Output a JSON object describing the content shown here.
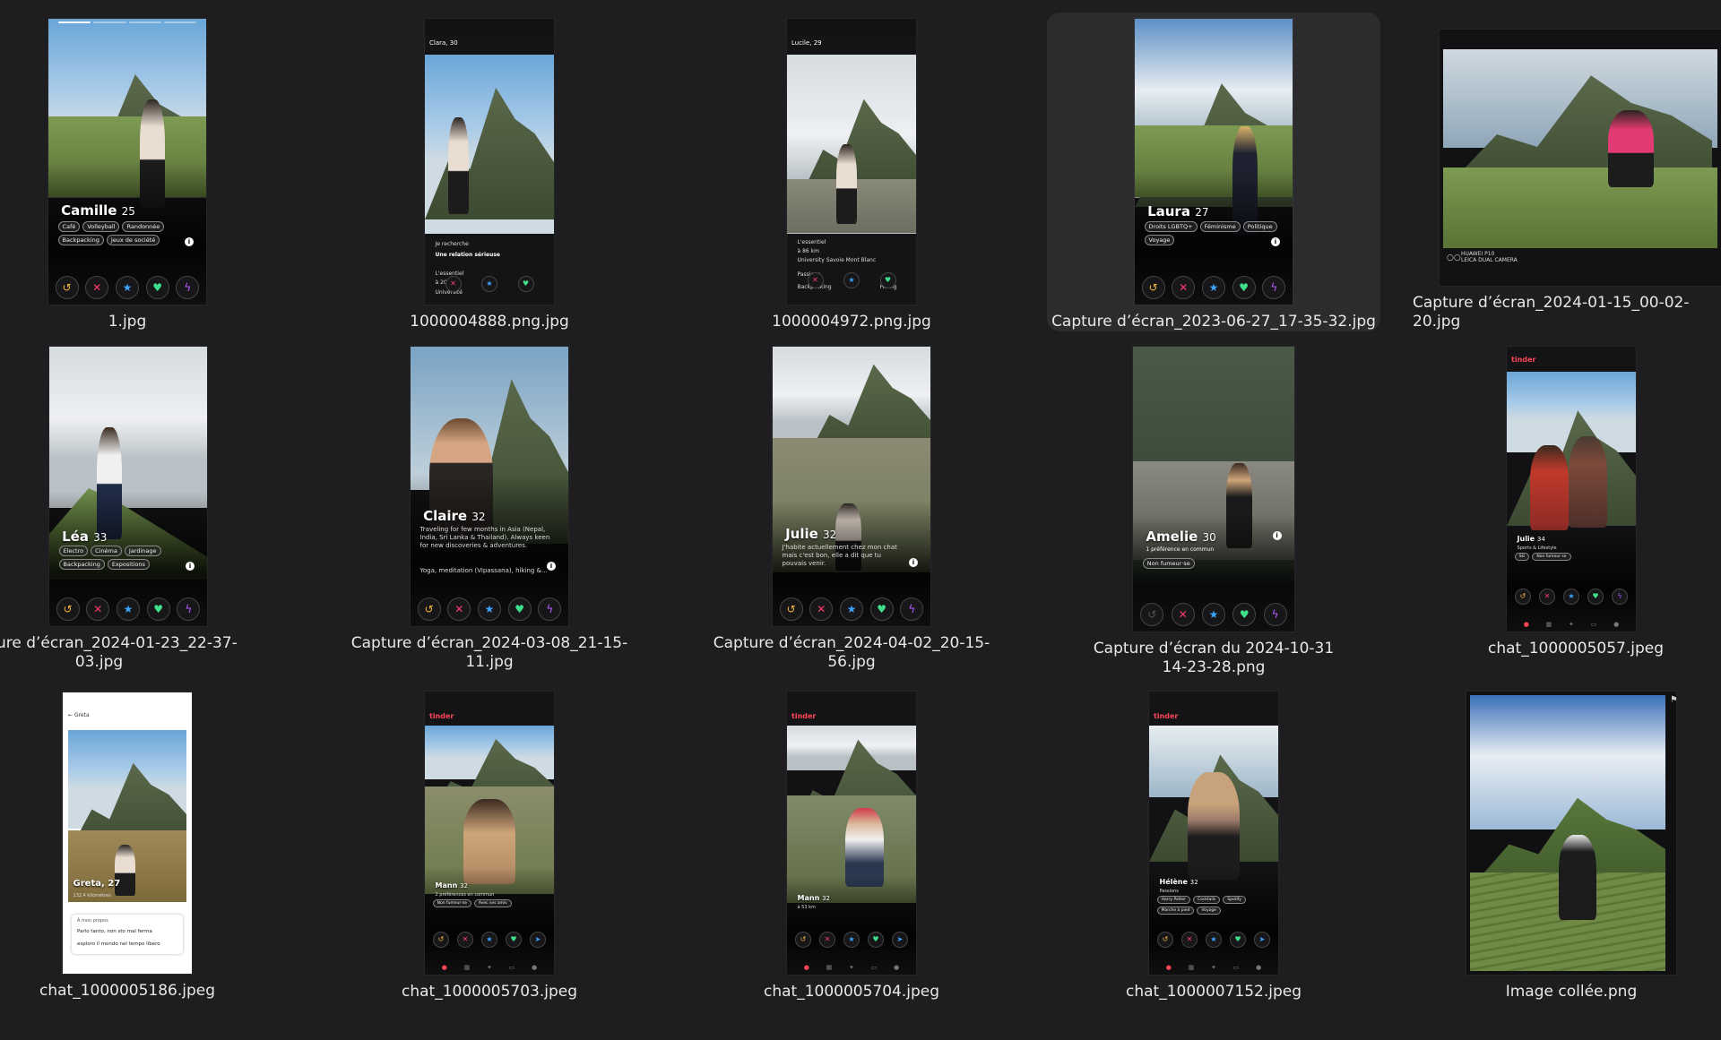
{
  "files": [
    {
      "name": "1.jpg",
      "profile": {
        "name": "Camille",
        "age": "25",
        "chips": [
          "Café",
          "Volleyball",
          "Randonnée",
          "Backpacking",
          "Jeux de société"
        ]
      }
    },
    {
      "name": "1000004888.png.jpg",
      "profile": {
        "name": "Clara, 30",
        "line1": "Je recherche",
        "line2": "Une relation sérieuse",
        "line3": "L'essentiel",
        "line4": "à 20 km",
        "line5": "Université"
      }
    },
    {
      "name": "1000004972.png.jpg",
      "profile": {
        "name": "Lucile, 29",
        "line1": "L'essentiel",
        "line2": "à 86 km",
        "line3": "University Savoie Mont Blanc",
        "line4": "Passions",
        "line5": "Backpacking",
        "line6": "Hiking"
      }
    },
    {
      "name": "Capture d’écran_2023-06-27_17-35-32.jpg",
      "profile": {
        "name": "Laura",
        "age": "27",
        "chips": [
          "Droits LGBTQ+",
          "Féminisme",
          "Politique",
          "Voyage"
        ]
      }
    },
    {
      "name": "Capture d’écran_2024-01-15_00-02-20.jpg",
      "camera": "HUAWEI P10\nLEICA DUAL CAMERA"
    },
    {
      "name": "Capture d’écran_2024-01-23_22-37-03.jpg",
      "profile": {
        "name": "Léa",
        "age": "33",
        "chips": [
          "Electro",
          "Cinéma",
          "Jardinage",
          "Backpacking",
          "Expositions"
        ]
      }
    },
    {
      "name": "Capture d’écran_2024-03-08_21-15-11.jpg",
      "profile": {
        "name": "Claire",
        "age": "32",
        "bio": "Traveling for few months in Asia (Nepal, India, Sri Lanka & Thailand). Always keen for new discoveries & adventures.",
        "bio2": "Yoga, meditation (Vipassana), hiking &..."
      }
    },
    {
      "name": "Capture d’écran_2024-04-02_20-15-56.jpg",
      "profile": {
        "name": "Julie",
        "age": "32",
        "bio": "J'habite actuellement chez mon chat mais c'est bon, elle a dit que tu pouvais venir."
      }
    },
    {
      "name": "Capture d’écran du 2024-10-31\n14-23-28.png",
      "profile": {
        "name": "Amelie",
        "age": "30",
        "line1": "1 préférence en commun",
        "chip": "Non fumeur·se"
      }
    },
    {
      "name": "chat_1000005057.jpeg",
      "brand": "tinder",
      "profile": {
        "name": "Julie",
        "age": "34",
        "line1": "Sports & Lifestyle",
        "chips": [
          "Ski",
          "Non fumeur·se"
        ]
      }
    },
    {
      "name": "chat_1000005186.jpeg",
      "profile": {
        "name": "Greta, 27",
        "header": "Greta",
        "line1": "À mon propos",
        "line2": "Parlo tanto, non sto mai ferma",
        "line3": "esploro il mondo nel tempo libero",
        "line4": "132,4 kilomètres"
      }
    },
    {
      "name": "chat_1000005703.jpeg",
      "brand": "tinder",
      "profile": {
        "name": "Mann",
        "age": "32",
        "line1": "2 préférences en commun",
        "chips": [
          "Non fumeur·se",
          "Avec ses amis"
        ]
      }
    },
    {
      "name": "chat_1000005704.jpeg",
      "brand": "tinder",
      "profile": {
        "name": "Mann",
        "age": "32",
        "line1": "à 53 km"
      }
    },
    {
      "name": "chat_1000007152.jpeg",
      "brand": "tinder",
      "profile": {
        "name": "Hélène",
        "age": "32",
        "line1": "Passions",
        "chips": [
          "Harry Potter",
          "Cocktails",
          "Spotify",
          "Marche à pied",
          "Voyage"
        ]
      }
    },
    {
      "name": "Image collée.png"
    }
  ]
}
